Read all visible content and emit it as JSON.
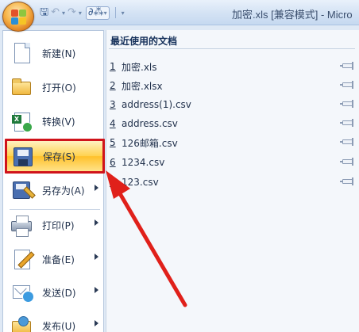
{
  "titlebar": {
    "title": "加密.xls [兼容模式] - Micro",
    "office_button_icon": "office-logo-icon",
    "quick_access": {
      "save_icon": "save-icon",
      "undo_icon": "undo-icon",
      "redo_icon": "redo-icon",
      "group_icons": [
        "chart-icon",
        "connector-icon"
      ],
      "customize_icon": "customize-qat-icon"
    }
  },
  "menu": {
    "commands": [
      {
        "id": "new",
        "label": "新建(N)",
        "icon": "new-document-icon",
        "has_submenu": false
      },
      {
        "id": "open",
        "label": "打开(O)",
        "icon": "open-folder-icon",
        "has_submenu": false
      },
      {
        "id": "convert",
        "label": "转换(V)",
        "icon": "convert-icon",
        "has_submenu": false
      },
      {
        "id": "save",
        "label": "保存(S)",
        "icon": "save-disk-icon",
        "has_submenu": false,
        "selected": true
      },
      {
        "id": "save-as",
        "label": "另存为(A)",
        "icon": "save-as-icon",
        "has_submenu": true
      },
      {
        "id": "print",
        "label": "打印(P)",
        "icon": "printer-icon",
        "has_submenu": true
      },
      {
        "id": "prepare",
        "label": "准备(E)",
        "icon": "prepare-icon",
        "has_submenu": true
      },
      {
        "id": "send",
        "label": "发送(D)",
        "icon": "send-icon",
        "has_submenu": true
      },
      {
        "id": "publish",
        "label": "发布(U)",
        "icon": "publish-icon",
        "has_submenu": true
      }
    ],
    "recent": {
      "title": "最近使用的文档",
      "documents": [
        {
          "num": "1",
          "name": "加密.xls"
        },
        {
          "num": "2",
          "name": "加密.xlsx"
        },
        {
          "num": "3",
          "name": "address(1).csv"
        },
        {
          "num": "4",
          "name": "address.csv"
        },
        {
          "num": "5",
          "name": "126邮箱.csv"
        },
        {
          "num": "6",
          "name": "1234.csv"
        },
        {
          "num": "7",
          "name": "123.csv"
        }
      ]
    }
  },
  "colors": {
    "highlight_border": "#d0131b",
    "annotation_arrow": "#e0201a",
    "selected_fill": "#ffd24f",
    "menu_background": "#dfe9f5"
  }
}
